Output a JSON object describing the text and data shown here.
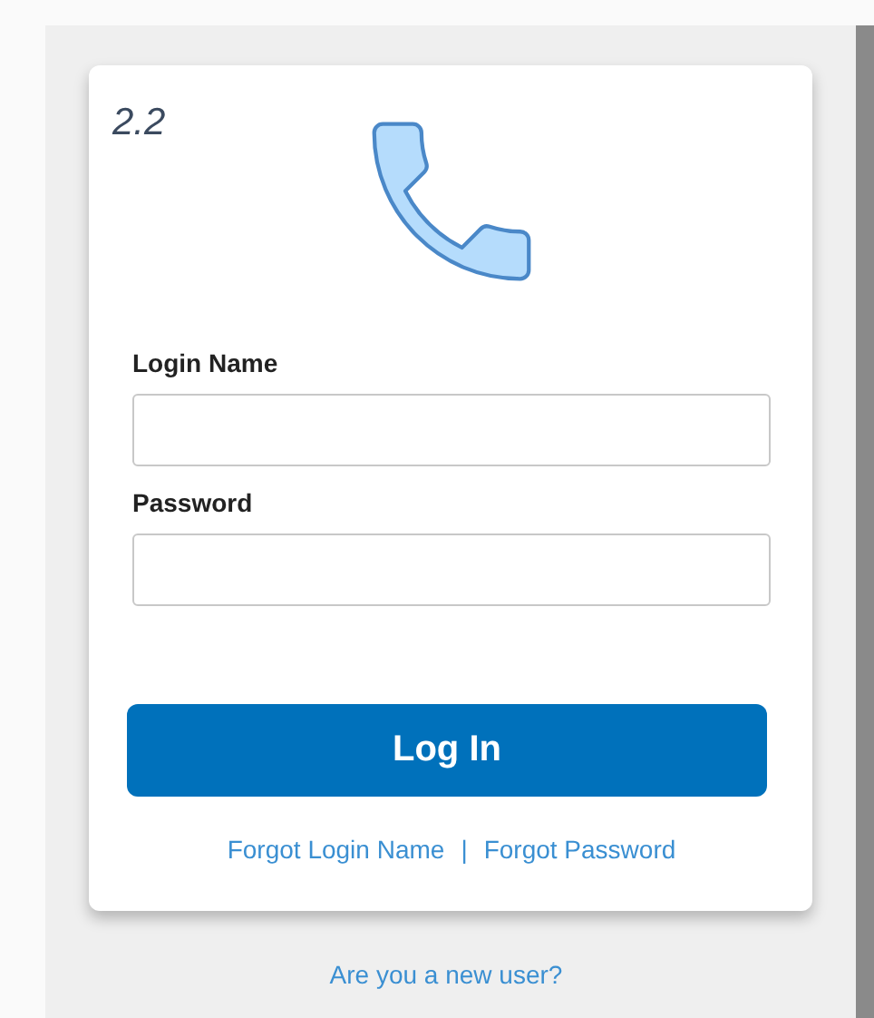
{
  "version": "2.2",
  "fields": [
    {
      "label": "Login Name"
    },
    {
      "label": "Password"
    }
  ],
  "submit_button": "Log In",
  "help_links": [
    "Forgot Login Name",
    "Forgot Password"
  ],
  "link_separator": "|",
  "new_user_link": "Are you a new user?"
}
